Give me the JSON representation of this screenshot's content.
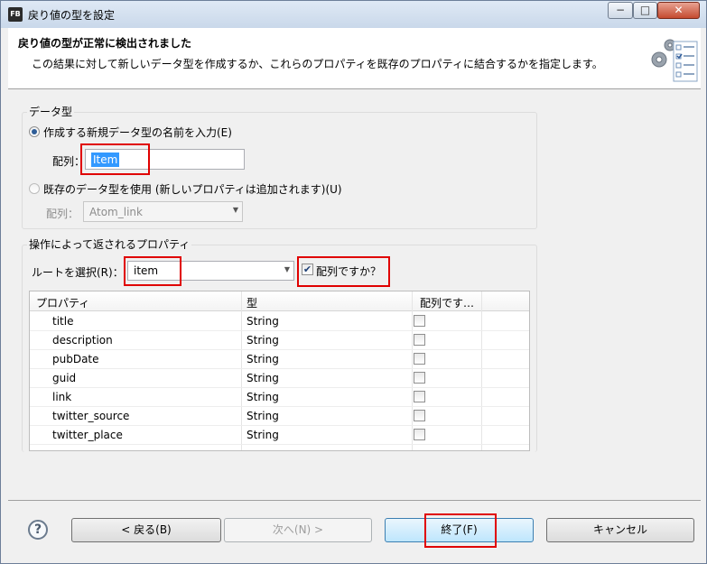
{
  "window": {
    "title": "戻り値の型を設定",
    "app_icon_text": "FB",
    "minimize": "−",
    "maximize": "□",
    "close": "✕"
  },
  "header": {
    "title": "戻り値の型が正常に検出されました",
    "description": "この結果に対して新しいデータ型を作成するか、これらのプロパティを既存のプロパティに結合するかを指定します。",
    "graphic": "settings-wizard-graphic"
  },
  "datatype_group": {
    "label": "データ型",
    "option_new": {
      "label": "作成する新規データ型の名前を入力(E)",
      "selected": true
    },
    "new_array_label": "配列：",
    "new_name_value": "Item",
    "option_existing": {
      "label": "既存のデータ型を使用 (新しいプロパティは追加されます)(U)",
      "selected": false
    },
    "existing_array_label": "配列：",
    "existing_value": "Atom_link"
  },
  "properties_group": {
    "label": "操作によって返されるプロパティ",
    "root_label": "ルートを選択(R)：",
    "root_value": "item",
    "is_array_label": "配列ですか？",
    "is_array_checked": true,
    "columns": [
      "プロパティ",
      "型",
      "配列です…"
    ],
    "rows": [
      {
        "name": "title",
        "type": "String",
        "is_array": false
      },
      {
        "name": "description",
        "type": "String",
        "is_array": false
      },
      {
        "name": "pubDate",
        "type": "String",
        "is_array": false
      },
      {
        "name": "guid",
        "type": "String",
        "is_array": false
      },
      {
        "name": "link",
        "type": "String",
        "is_array": false
      },
      {
        "name": "twitter_source",
        "type": "String",
        "is_array": false
      },
      {
        "name": "twitter_place",
        "type": "String",
        "is_array": false
      }
    ]
  },
  "buttons": {
    "help": "?",
    "back": "< 戻る(B)",
    "next": "次へ(N) >",
    "finish": "終了(F)",
    "cancel": "キャンセル"
  },
  "colors": {
    "highlight_box": "#e00000",
    "selection": "#3399ff"
  }
}
